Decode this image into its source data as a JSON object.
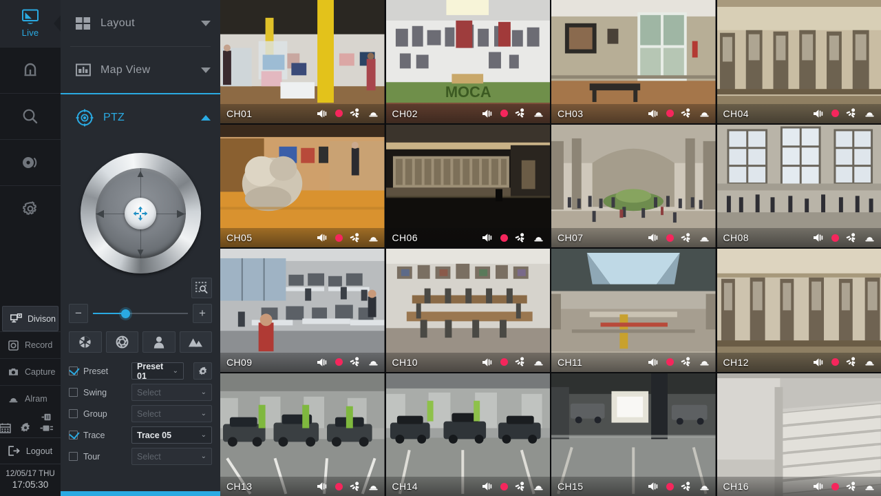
{
  "app": {
    "title": "NVR Live View"
  },
  "colors": {
    "accent": "#2aaae2",
    "record": "#f5265c",
    "panel_bg": "#262a30",
    "rail_bg": "#17191d"
  },
  "rail": {
    "active": {
      "label": "Live",
      "icon": "monitor-icon"
    },
    "icons": [
      {
        "name": "playback-icon",
        "label": ""
      },
      {
        "name": "search-icon",
        "label": ""
      },
      {
        "name": "disc-icon",
        "label": ""
      },
      {
        "name": "settings-gear-icon",
        "label": ""
      }
    ],
    "items": [
      {
        "label": "Divison",
        "icon": "division-icon",
        "selected": true
      },
      {
        "label": "Record",
        "icon": "record-icon",
        "selected": false
      },
      {
        "label": "Capture",
        "icon": "capture-icon",
        "selected": false
      },
      {
        "label": "Alram",
        "icon": "alarm-icon",
        "selected": false
      }
    ],
    "status_icons": [
      "usb-icon",
      "calendar-icon",
      "gear-icon",
      "network-icon"
    ],
    "logout": {
      "label": "Logout",
      "icon": "logout-icon"
    },
    "clock": {
      "date": "12/05/17 THU",
      "time": "17:05:30"
    }
  },
  "panel": {
    "sections": [
      {
        "id": "layout",
        "label": "Layout",
        "icon": "layout-grid-icon",
        "open": false,
        "caret": "chevron-down-icon"
      },
      {
        "id": "mapview",
        "label": "Map View",
        "icon": "map-view-icon",
        "open": false,
        "caret": "chevron-down-icon"
      },
      {
        "id": "ptz",
        "label": "PTZ",
        "icon": "ptz-target-icon",
        "open": true,
        "caret": "chevron-up-icon"
      }
    ],
    "ptz": {
      "joystick": {
        "up": "▲",
        "down": "▼",
        "left": "◀",
        "right": "▶",
        "center_icon": "move-arrows-icon"
      },
      "area_zoom": {
        "label": "",
        "icon": "area-zoom-icon"
      },
      "zoom": {
        "minus_label": "−",
        "plus_label": "+",
        "value": 34
      },
      "function_buttons": [
        {
          "name": "iris-close-button",
          "icon": "aperture-filled-icon"
        },
        {
          "name": "iris-open-button",
          "icon": "aperture-open-icon"
        },
        {
          "name": "focus-near-button",
          "icon": "person-icon"
        },
        {
          "name": "focus-far-button",
          "icon": "mountain-icon"
        }
      ],
      "items": [
        {
          "label": "Preset",
          "checked": true,
          "value": "Preset 01",
          "placeholder": "Select",
          "has_gear": true
        },
        {
          "label": "Swing",
          "checked": false,
          "value": "",
          "placeholder": "Select",
          "has_gear": false
        },
        {
          "label": "Group",
          "checked": false,
          "value": "",
          "placeholder": "Select",
          "has_gear": false
        },
        {
          "label": "Trace",
          "checked": true,
          "value": "Trace 05",
          "placeholder": "Select",
          "has_gear": false
        },
        {
          "label": "Tour",
          "checked": false,
          "value": "",
          "placeholder": "Select",
          "has_gear": false
        }
      ]
    }
  },
  "grid": {
    "rows": 4,
    "cols": 4,
    "selected_channel": "CH06",
    "tile_icons": [
      "speaker-icon",
      "record-dot-icon",
      "motion-person-icon",
      "alarm-bell-icon"
    ],
    "channels": [
      {
        "name": "CH01",
        "scene": "gallery-yellow-column"
      },
      {
        "name": "CH02",
        "scene": "gallery-white-moca"
      },
      {
        "name": "CH03",
        "scene": "gallery-bench-door"
      },
      {
        "name": "CH04",
        "scene": "museum-balcony-cases"
      },
      {
        "name": "CH05",
        "scene": "gallery-sculpture-wood"
      },
      {
        "name": "CH06",
        "scene": "museum-frieze-hall"
      },
      {
        "name": "CH07",
        "scene": "museum-great-hall"
      },
      {
        "name": "CH08",
        "scene": "museum-windows-hall"
      },
      {
        "name": "CH09",
        "scene": "open-office-desks"
      },
      {
        "name": "CH10",
        "scene": "meeting-room-tables"
      },
      {
        "name": "CH11",
        "scene": "atrium-skylight"
      },
      {
        "name": "CH12",
        "scene": "museum-display-cases"
      },
      {
        "name": "CH13",
        "scene": "parking-garage-cars"
      },
      {
        "name": "CH14",
        "scene": "parking-garage-ramp"
      },
      {
        "name": "CH15",
        "scene": "parking-garage-dark"
      },
      {
        "name": "CH16",
        "scene": "concrete-stairwell"
      }
    ]
  }
}
